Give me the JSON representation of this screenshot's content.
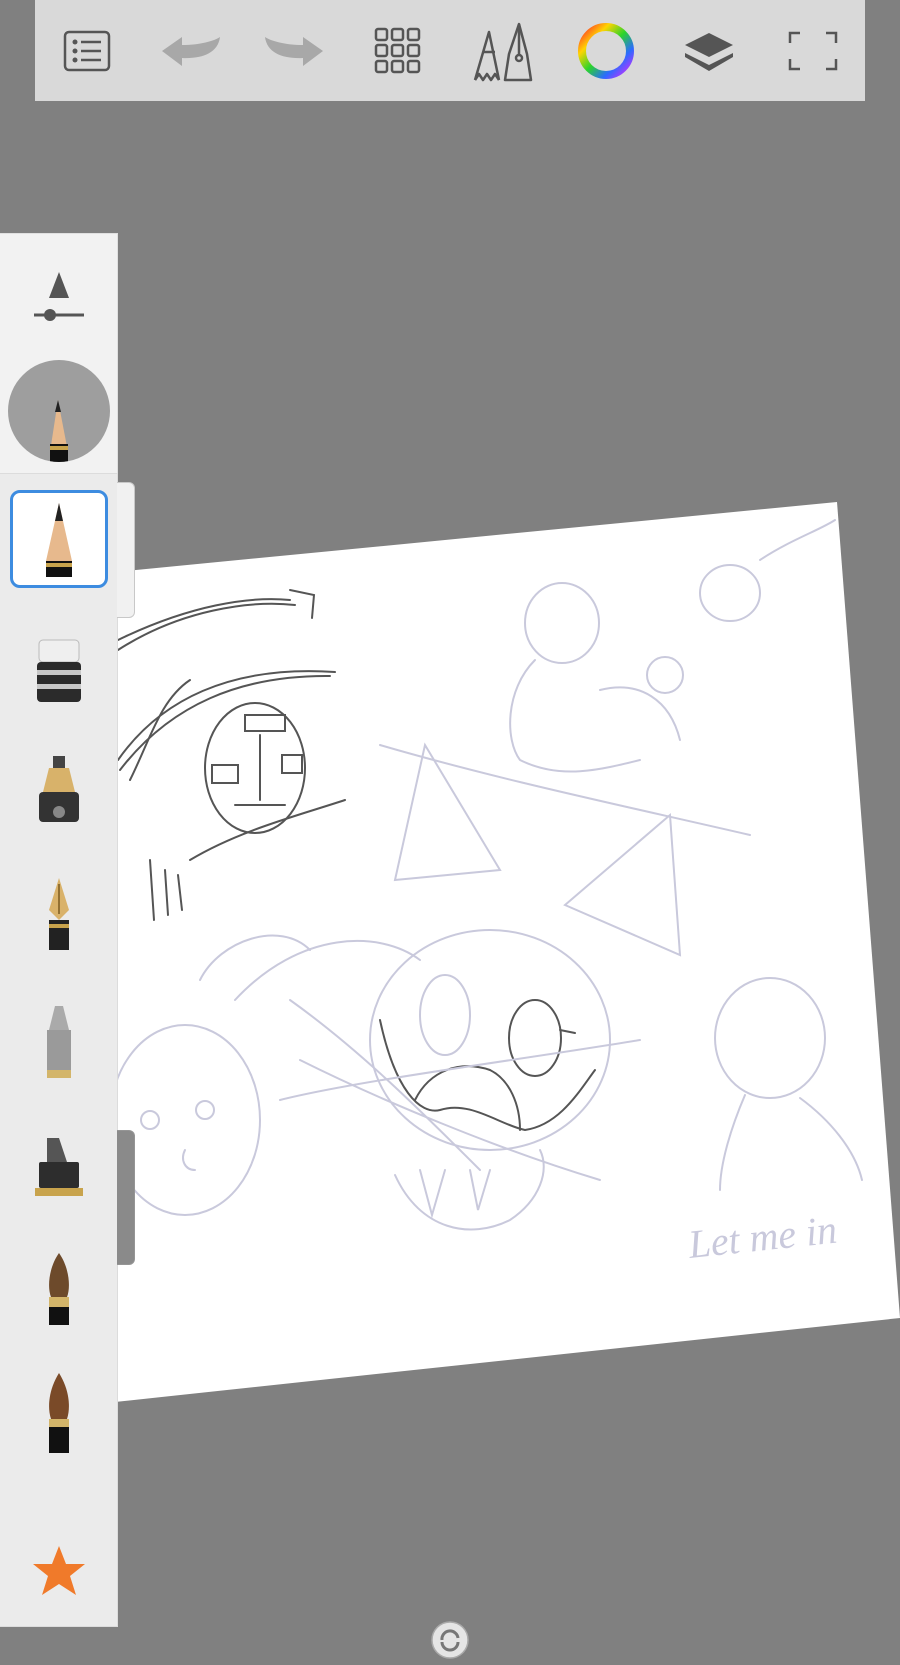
{
  "toolbar": {
    "buttons": [
      {
        "icon": "list-icon"
      },
      {
        "icon": "undo-icon"
      },
      {
        "icon": "redo-icon"
      },
      {
        "icon": "grid-icon"
      },
      {
        "icon": "brush-tools-icon"
      },
      {
        "icon": "color-wheel-icon"
      },
      {
        "icon": "layers-icon"
      },
      {
        "icon": "fullscreen-icon"
      }
    ]
  },
  "canvas": {
    "handwritten_text": "Let me in"
  },
  "brush_panel": {
    "brushes": [
      {
        "name": "pencil",
        "icon": "pencil-icon",
        "selected": true
      },
      {
        "name": "eraser",
        "icon": "eraser-icon"
      },
      {
        "name": "airbrush",
        "icon": "airbrush-icon"
      },
      {
        "name": "fountain-pen",
        "icon": "pen-icon"
      },
      {
        "name": "marker",
        "icon": "marker-icon"
      },
      {
        "name": "chisel-marker",
        "icon": "chisel-marker-icon"
      },
      {
        "name": "round-brush",
        "icon": "brush-icon"
      },
      {
        "name": "ink-brush",
        "icon": "ink-brush-icon"
      }
    ],
    "favorites_icon": "star-icon"
  },
  "colors": {
    "accent": "#3d8ce0",
    "background": "#808080",
    "toolbar": "#d9d9d9",
    "star": "#f07a2a"
  }
}
